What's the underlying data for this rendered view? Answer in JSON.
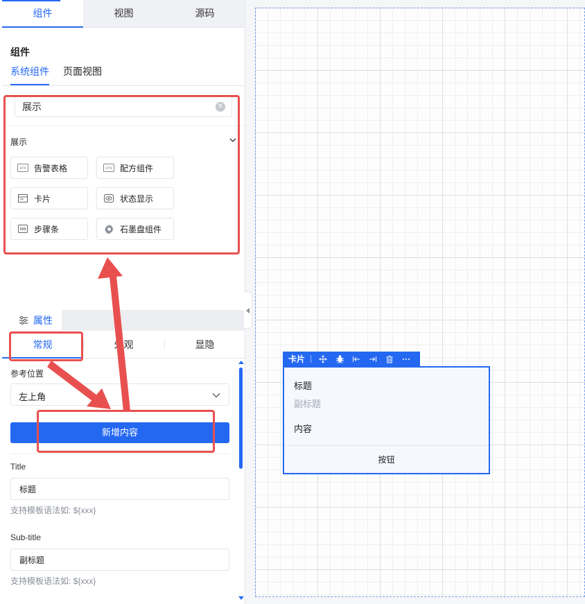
{
  "top_tabs": [
    "组件",
    "视图",
    "源码"
  ],
  "components_panel": {
    "title": "组件",
    "sub_tabs": [
      "系统组件",
      "页面视图"
    ],
    "search_value": "展示",
    "group_title": "展示",
    "items": [
      {
        "label": "告警表格",
        "icon": "btn-icon"
      },
      {
        "label": "配方组件",
        "icon": "btn-icon"
      },
      {
        "label": "卡片",
        "icon": "card-icon"
      },
      {
        "label": "状态显示",
        "icon": "eye-icon"
      },
      {
        "label": "步骤条",
        "icon": "steps-icon"
      },
      {
        "label": "石墨盘组件",
        "icon": "gear-icon"
      }
    ]
  },
  "properties": {
    "header": "属性",
    "tabs": [
      "常规",
      "外观",
      "显隐"
    ],
    "position_label": "参考位置",
    "position_value": "左上角",
    "add_button": "新增内容",
    "title_label": "Title",
    "title_value": "标题",
    "title_hint": "支持模板语法如: ${xxx}",
    "subtitle_label": "Sub-title",
    "subtitle_value": "副标题",
    "subtitle_hint": "支持模板语法如: ${xxx}"
  },
  "card_preview": {
    "toolbar_name": "卡片",
    "toolbar_icons": [
      "move-icon",
      "bug-icon",
      "indent-left-icon",
      "indent-right-icon",
      "trash-icon",
      "more-icon"
    ],
    "title": "标题",
    "subtitle": "副标题",
    "content": "内容",
    "button": "按钮"
  },
  "colors": {
    "accent": "#2468f2",
    "highlight_red": "#e8504f"
  }
}
